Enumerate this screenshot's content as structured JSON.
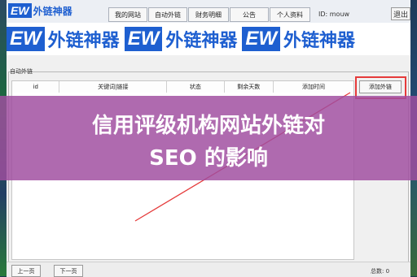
{
  "app": {
    "logo_ew": "EW",
    "logo_cn": "外链神器",
    "close_label": "退出",
    "id_label": "ID: mouw"
  },
  "menu": {
    "items": [
      "我的网站",
      "自动外链",
      "财务明细",
      "公告",
      "个人资料"
    ]
  },
  "banner": {
    "repeat": [
      {
        "ew": "EW",
        "cn": "外链神器"
      },
      {
        "ew": "EW",
        "cn": "外链神器"
      },
      {
        "ew": "EW",
        "cn": "外链神器"
      }
    ]
  },
  "panel": {
    "group_label": "自动外链",
    "add_button": "添加外链"
  },
  "table": {
    "columns": [
      "id",
      "关键词|链接",
      "状态",
      "剩余天数",
      "添加时间"
    ]
  },
  "overlay": {
    "line1": "信用评级机构网站外链对",
    "line2": "SEO 的影响"
  },
  "pager": {
    "prev": "上一页",
    "next": "下一页",
    "total": "总数: 0"
  },
  "colors": {
    "brand_blue": "#1e5fd0",
    "overlay_purple": "#a04ea0",
    "highlight_red": "#e53a3a"
  }
}
